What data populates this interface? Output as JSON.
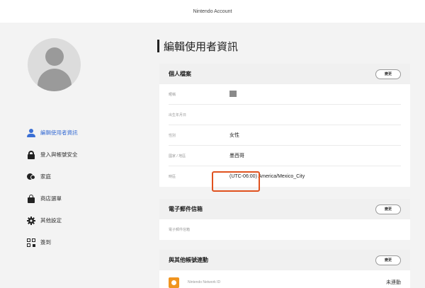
{
  "topbar": {
    "title": "Nintendo Account"
  },
  "sidebar": {
    "items": [
      {
        "label": "編輯使用者資訊",
        "icon": "user-icon",
        "active": true
      },
      {
        "label": "登入與帳號安全",
        "icon": "lock-icon",
        "active": false
      },
      {
        "label": "家庭",
        "icon": "family-icon",
        "active": false
      },
      {
        "label": "商店選單",
        "icon": "shopping-bag-icon",
        "active": false
      },
      {
        "label": "其他設定",
        "icon": "gear-icon",
        "active": false
      },
      {
        "label": "簽到",
        "icon": "qr-code-icon",
        "active": false
      }
    ]
  },
  "main": {
    "title": "編輯使用者資訊",
    "profile": {
      "title": "個人檔案",
      "edit_label": "變更",
      "rows": [
        {
          "label": "暱稱",
          "value": ""
        },
        {
          "label": "出生年月日",
          "value": ""
        },
        {
          "label": "性別",
          "value": "女性"
        },
        {
          "label": "國家 / 地區",
          "value": "墨西哥"
        },
        {
          "label": "時區",
          "value": "(UTC-06:00) America/Mexico_City"
        }
      ]
    },
    "email": {
      "title": "電子郵件信箱",
      "edit_label": "變更",
      "rows": [
        {
          "label": "電子郵件信箱",
          "value": ""
        }
      ]
    },
    "linked": {
      "title": "與其他帳號連動",
      "edit_label": "變更",
      "items": [
        {
          "name": "Nintendo Network ID",
          "status": "未連動"
        }
      ]
    }
  },
  "colors": {
    "accent": "#3b6fd4",
    "highlight": "#e0521f",
    "nnid": "#f0941f"
  }
}
